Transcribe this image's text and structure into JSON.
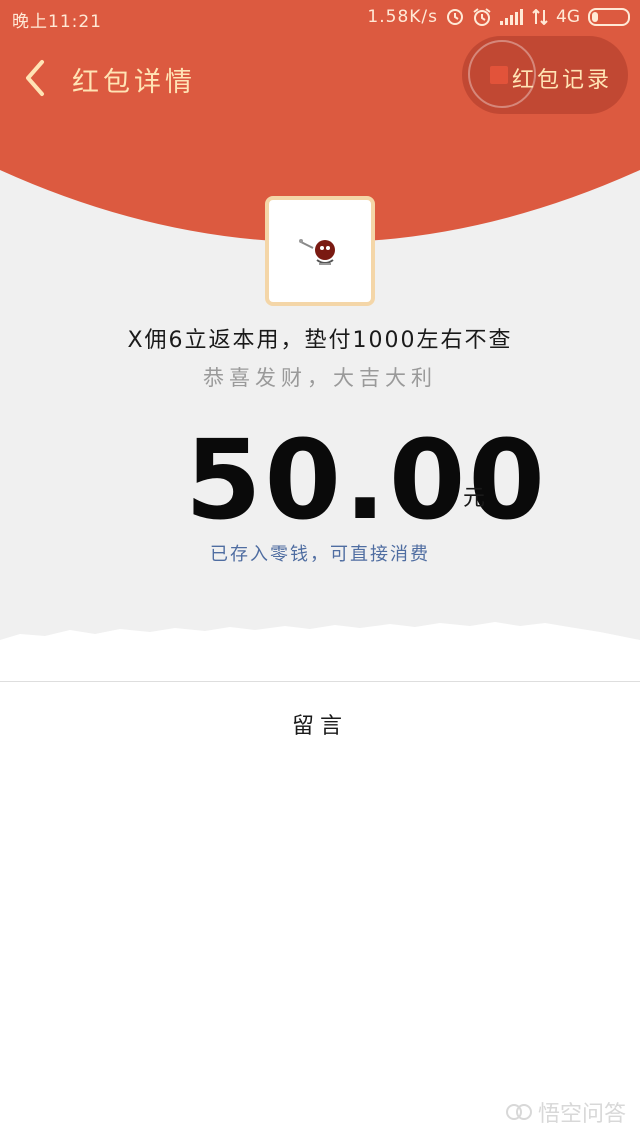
{
  "status_bar": {
    "time": "晚上11:21",
    "speed": "1.58K/s",
    "network": "4G"
  },
  "nav": {
    "title": "红包详情",
    "records_label": "红包记录"
  },
  "packet": {
    "sender_message": "X佣6立返本用，垫付1000左右不查",
    "greeting": "恭喜发财，大吉大利",
    "amount": "50.00",
    "unit": "元",
    "deposit_note": "已存入零钱，可直接消费"
  },
  "message_section": {
    "label": "留言"
  },
  "watermark": {
    "text": "悟空问答"
  },
  "colors": {
    "header_red": "#dc5a40",
    "gold_text": "#ffe4b5",
    "link_blue": "#4f6da1",
    "background_grey": "#f0f0f0"
  }
}
